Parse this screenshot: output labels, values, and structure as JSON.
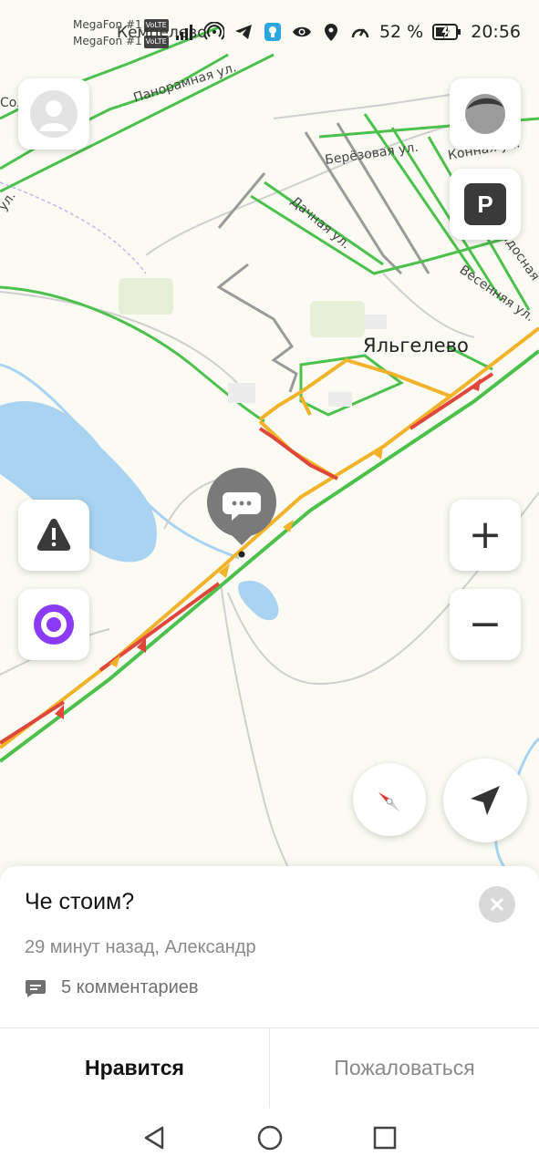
{
  "status_bar": {
    "sim1": "MegaFon #1",
    "sim2": "MegaFon #1",
    "volte_badge": "VoLTE",
    "carrier_overlay": "Кемпелево",
    "battery": "52 %",
    "time": "20:56",
    "icons": [
      "signal-icon",
      "hotspot-icon",
      "telegram-icon",
      "bulb-icon",
      "eye-icon",
      "location-icon",
      "speed-icon",
      "battery-icon"
    ]
  },
  "map": {
    "street_labels": [
      "Панорамная ул.",
      "Берёзовая ул.",
      "Конная ул.",
      "Дачная ул.",
      "Весенняя ул.",
      "Радосная",
      "ул.",
      "Солов"
    ],
    "place_label": "Яльгелево",
    "traffic_colors": {
      "free": "#4cc04c",
      "slow": "#f2b32a",
      "jam": "#e0473c"
    }
  },
  "controls": {
    "profile": "avatar-icon",
    "layers": "layers-icon",
    "parking_label": "P",
    "alert": "warning-icon",
    "alice": "alice-icon",
    "zoom_in": "+",
    "zoom_out": "−",
    "compass": "compass-icon",
    "locate": "navigation-arrow-icon"
  },
  "marker": {
    "icon": "chat-bubble-icon"
  },
  "sheet": {
    "title": "Че стоим?",
    "meta": "29 минут назад, Александр",
    "comments": "5 комментариев",
    "like": "Нравится",
    "report": "Пожаловаться"
  },
  "nav": {
    "back": "back-icon",
    "home": "home-icon",
    "recents": "recents-icon"
  }
}
